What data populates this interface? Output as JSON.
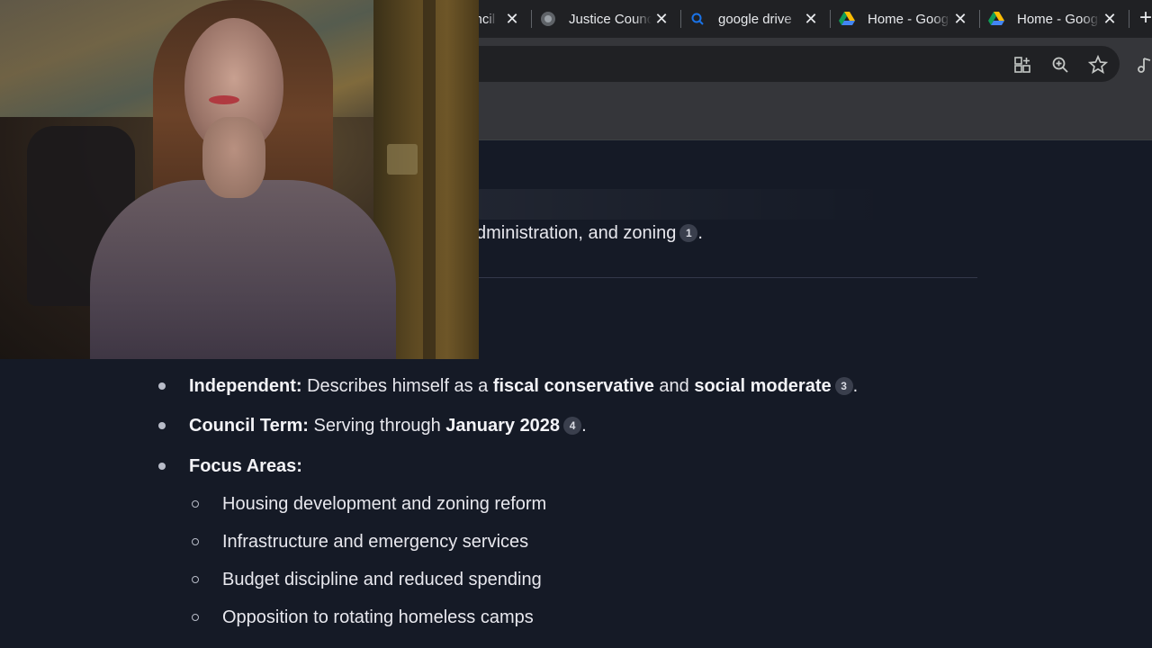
{
  "browser": {
    "tabs": [
      {
        "title": "Council",
        "favicon": "globe-icon"
      },
      {
        "title": "Justice Council",
        "favicon": "justice-icon"
      },
      {
        "title": "google drive",
        "favicon": "search-icon"
      },
      {
        "title": "Home - Google Drive",
        "favicon": "google-drive-icon"
      },
      {
        "title": "Home - Google Drive",
        "favicon": "google-drive-icon"
      }
    ],
    "toolbar_icons": [
      "apps-icon",
      "zoom-icon",
      "star-icon",
      "media-icon"
    ]
  },
  "content": {
    "partial_line": {
      "text": "dministration, and zoning",
      "cite": "1",
      "end": "."
    },
    "bullets": [
      {
        "label": "Independent:",
        "t1": " Describes himself as a ",
        "b1": "fiscal conservative",
        "t2": " and ",
        "b2": "social moderate",
        "cite": "3",
        "end": "."
      },
      {
        "label": "Council Term:",
        "t1": " Serving through ",
        "b1": "January 2028",
        "cite": "4",
        "end": "."
      },
      {
        "label": "Focus Areas:"
      }
    ],
    "focus_areas": [
      "Housing development and zoning reform",
      "Infrastructure and emergency services",
      "Budget discipline and reduced spending",
      "Opposition to rotating homeless camps"
    ]
  },
  "colors": {
    "page_bg": "#151a26",
    "chrome_dark": "#202124",
    "chrome_toolbar": "#35363a"
  }
}
